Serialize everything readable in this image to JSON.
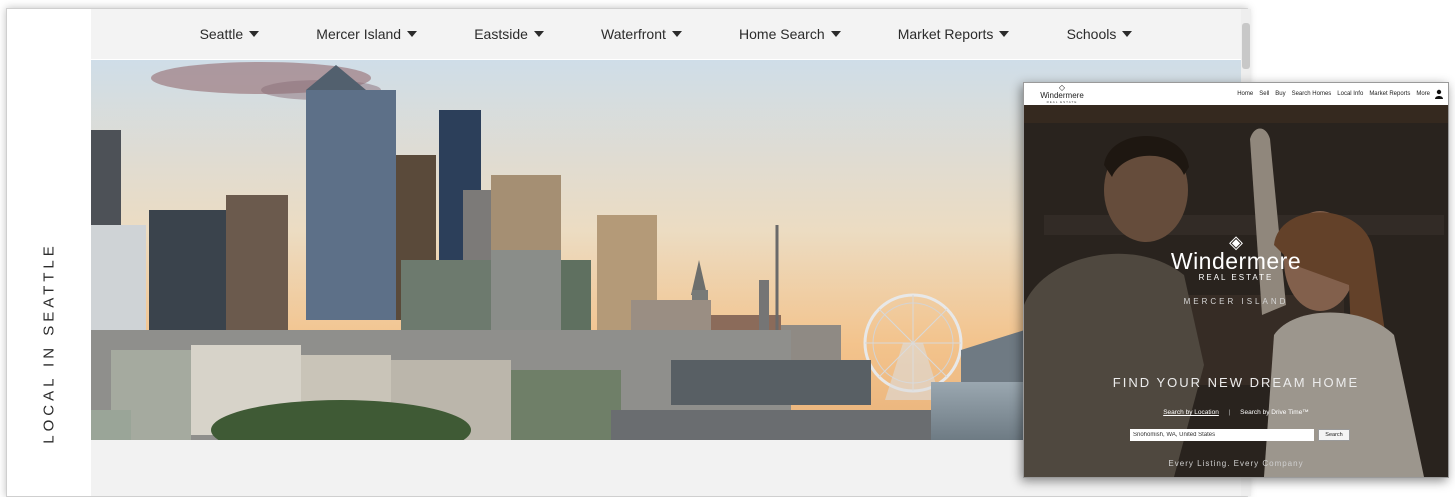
{
  "sidebar": {
    "label": "LOCAL IN SEATTLE"
  },
  "nav": {
    "items": [
      {
        "label": "Seattle"
      },
      {
        "label": "Mercer Island"
      },
      {
        "label": "Eastside"
      },
      {
        "label": "Waterfront"
      },
      {
        "label": "Home Search"
      },
      {
        "label": "Market Reports"
      },
      {
        "label": "Schools"
      }
    ]
  },
  "overlay": {
    "logo": {
      "name": "Windermere",
      "sub": "REAL ESTATE"
    },
    "menu": [
      "Home",
      "Sell",
      "Buy",
      "Search Homes",
      "Local Info",
      "Market Reports",
      "More"
    ],
    "brand": {
      "name": "Windermere",
      "sub": "REAL ESTATE",
      "office": "MERCER ISLAND"
    },
    "headline": "FIND YOUR NEW DREAM HOME",
    "links": {
      "location": "Search by Location",
      "drive": "Search by Drive Time™"
    },
    "search": {
      "value": "Snohomish, WA, United States",
      "button": "Search"
    },
    "tagline": "Every Listing. Every Company"
  },
  "colors": {
    "nav_bg": "#f3f3f3",
    "text": "#2b2b2b",
    "sky_top": "#cfe0ec",
    "sky_bottom": "#f2c28a"
  }
}
